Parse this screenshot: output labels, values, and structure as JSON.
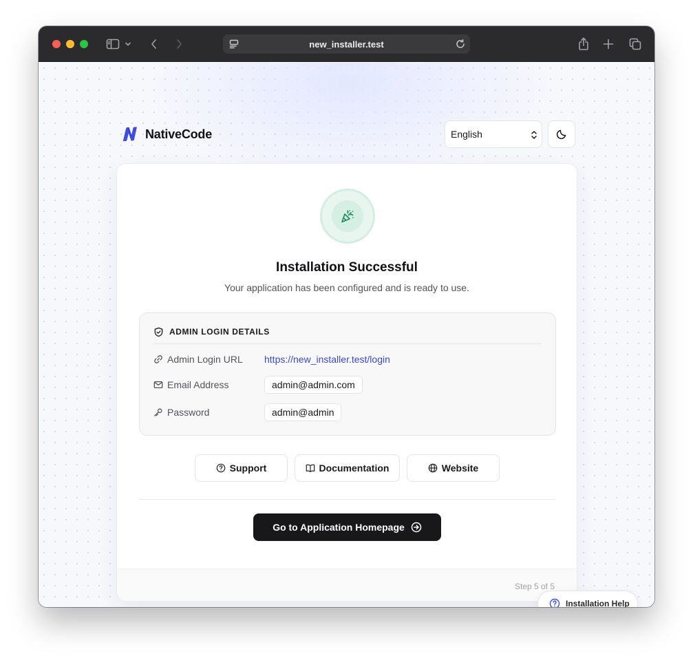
{
  "browser": {
    "url": "new_installer.test"
  },
  "header": {
    "brand_name": "NativeCode",
    "language_selected": "English"
  },
  "success": {
    "title": "Installation Successful",
    "subtitle": "Your application has been configured and is ready to use."
  },
  "admin_details": {
    "heading": "ADMIN LOGIN DETAILS",
    "rows": [
      {
        "label": "Admin Login URL",
        "value": "https://new_installer.test/login",
        "icon": "link-icon"
      },
      {
        "label": "Email Address",
        "value": "admin@admin.com",
        "icon": "mail-icon"
      },
      {
        "label": "Password",
        "value": "admin@admin",
        "icon": "key-icon"
      }
    ]
  },
  "links": {
    "support": "Support",
    "documentation": "Documentation",
    "website": "Website"
  },
  "primary_action": "Go to Application Homepage",
  "footer": {
    "step": "Step 5 of 5"
  },
  "help": {
    "label": "Installation Help"
  },
  "colors": {
    "accent_link": "#3b48c9",
    "success_bg": "#e8f6ef",
    "success_icon": "#1f8a5c",
    "primary_button": "#18181b",
    "brand_logo": "#3d4fe0"
  }
}
